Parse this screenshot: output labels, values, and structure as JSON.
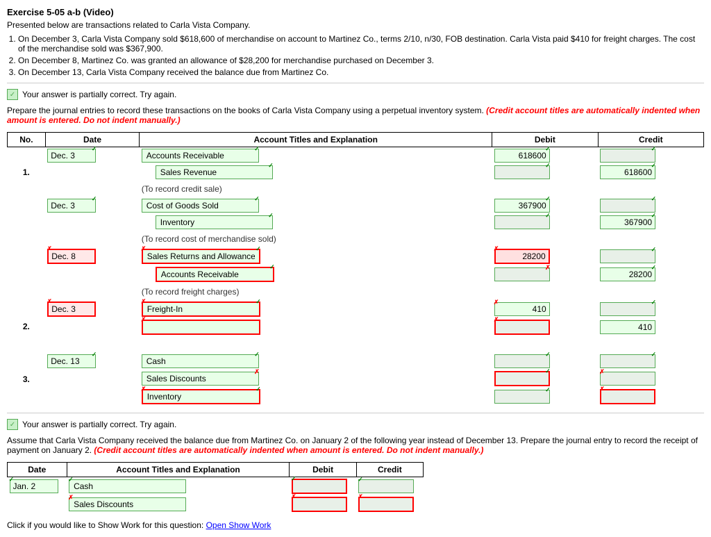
{
  "title": "Exercise 5-05 a-b (Video)",
  "intro": "Presented below are transactions related to Carla Vista Company.",
  "transactions": [
    "On December 3, Carla Vista Company sold $618,600 of merchandise on account to Martinez Co., terms 2/10, n/30, FOB destination. Carla Vista paid $410 for freight charges. The cost of the merchandise sold was $367,900.",
    "On December 8, Martinez Co. was granted an allowance of $28,200 for merchandise purchased on December 3.",
    "On December 13, Carla Vista Company received the balance due from Martinez Co."
  ],
  "status": "Your answer is partially correct.  Try again.",
  "instructions": "Prepare the journal entries to record these transactions on the books of Carla Vista Company using a perpetual inventory system.",
  "instructions_red": "(Credit account titles are automatically indented when amount is entered. Do not indent manually.)",
  "table_headers": {
    "no": "No.",
    "date": "Date",
    "acct": "Account Titles and Explanation",
    "debit": "Debit",
    "credit": "Credit"
  },
  "entries": [
    {
      "no": "1.",
      "rows": [
        {
          "date": "Dec. 3",
          "date_border": "green",
          "acct": "Accounts Receivable",
          "acct_indent": false,
          "debit": "618600",
          "credit": "",
          "tl": "",
          "tr": "✓",
          "dl": "",
          "dr": "✓",
          "cl": "",
          "cr": "✓"
        },
        {
          "date": "",
          "acct": "Sales Revenue",
          "acct_indent": true,
          "debit": "",
          "credit": "618600",
          "tl": "",
          "tr": "✓",
          "dl": "",
          "dr": "✓",
          "cl": "",
          "cr": "✓"
        },
        {
          "date": "",
          "acct": "(To record credit sale)",
          "acct_indent": false,
          "note": true,
          "debit": "",
          "credit": ""
        }
      ]
    },
    {
      "no": "",
      "rows": [
        {
          "date": "Dec. 3",
          "date_border": "green",
          "acct": "Cost of Goods Sold",
          "acct_indent": false,
          "debit": "367900",
          "credit": "",
          "tl": "",
          "tr": "✓",
          "dl": "",
          "dr": "✓",
          "cl": "",
          "cr": "✓"
        },
        {
          "date": "",
          "acct": "Inventory",
          "acct_indent": true,
          "debit": "",
          "credit": "367900",
          "tl": "",
          "tr": "✓",
          "dl": "",
          "dr": "✓",
          "cl": "",
          "cr": "✓"
        },
        {
          "date": "",
          "acct": "(To record cost of merchandise sold)",
          "acct_indent": false,
          "note": true,
          "debit": "",
          "credit": ""
        }
      ]
    },
    {
      "no": "",
      "rows": [
        {
          "date": "Dec. 8",
          "date_border": "red",
          "acct": "Sales Returns and Allowances",
          "acct_border": "red",
          "acct_indent": false,
          "debit": "28200",
          "credit": "",
          "tl": "✗",
          "tr": "✓",
          "dl": "✗",
          "dr": "",
          "cl": "",
          "cr": "✓"
        },
        {
          "date": "",
          "acct": "Accounts Receivable",
          "acct_border": "red",
          "acct_indent": true,
          "debit": "",
          "credit": "28200",
          "tl": "",
          "tr": "✓",
          "dl": "",
          "dr": "✗",
          "cl": "",
          "cr": "✓"
        },
        {
          "date": "",
          "acct": "(To record freight charges)",
          "acct_indent": false,
          "note": true,
          "debit": "",
          "credit": ""
        }
      ]
    }
  ],
  "entry2": {
    "no": "2.",
    "rows": [
      {
        "date": "Dec. 3",
        "date_border": "red",
        "acct": "Freight-In",
        "acct_border": "red",
        "acct_indent": false,
        "debit": "410",
        "credit": "",
        "tl": "✗",
        "tr": "✓",
        "dl": "✗",
        "dr": "",
        "cl": "",
        "cr": "✓"
      },
      {
        "date": "",
        "acct": "",
        "acct_border": "red",
        "acct_indent": false,
        "debit": "",
        "credit": "410",
        "tl": "",
        "tr": "",
        "dl": "✗",
        "dr": "",
        "cl": "✗",
        "cr": ""
      },
      {
        "date": "",
        "acct": "",
        "acct_indent": false,
        "note": false,
        "debit": "",
        "credit": ""
      }
    ]
  },
  "entry3": {
    "no": "3.",
    "rows": [
      {
        "date": "Dec. 13",
        "date_border": "green",
        "acct": "Cash",
        "acct_indent": false,
        "debit": "",
        "credit": "",
        "tl": "",
        "tr": "✓",
        "dl": "",
        "dr": "✓",
        "cl": "",
        "cr": "✓"
      },
      {
        "date": "",
        "acct": "Sales Discounts",
        "acct_indent": false,
        "debit": "",
        "credit": "",
        "tl": "",
        "tr": "✗",
        "dl": "",
        "dr": "✓",
        "cl": "✗",
        "cr": ""
      },
      {
        "date": "",
        "acct": "Inventory",
        "acct_border": "red",
        "acct_indent": false,
        "debit": "",
        "credit": "",
        "tl": "✗",
        "tr": "✓",
        "dl": "",
        "dr": "✓",
        "cl": "✗",
        "cr": ""
      }
    ]
  },
  "status2": "Your answer is partially correct.  Try again.",
  "part_b_instructions": "Assume that Carla Vista Company received the balance due from Martinez Co. on January 2 of the following year instead of December 13. Prepare the journal entry to record the receipt of payment on January 2.",
  "part_b_red": "(Credit account titles are automatically indented when amount is entered. Do not indent manually.)",
  "bottom_headers": {
    "date": "Date",
    "acct": "Account Titles and Explanation",
    "debit": "Debit",
    "credit": "Credit"
  },
  "bottom_rows": [
    {
      "date": "Jan. 2",
      "acct": "Cash",
      "debit": "",
      "credit": "",
      "tl": "✓",
      "tr": "",
      "dl": "✓",
      "dr": "",
      "cl": "✓",
      "cr": ""
    },
    {
      "date": "",
      "acct": "Sales Discounts",
      "debit": "",
      "credit": "",
      "tl": "✗",
      "tr": "",
      "dl": "✗",
      "dr": "",
      "cl": "✗",
      "cr": ""
    }
  ],
  "show_work_label": "Click if you would like to Show Work for this question:",
  "show_work_link": "Open Show Work"
}
